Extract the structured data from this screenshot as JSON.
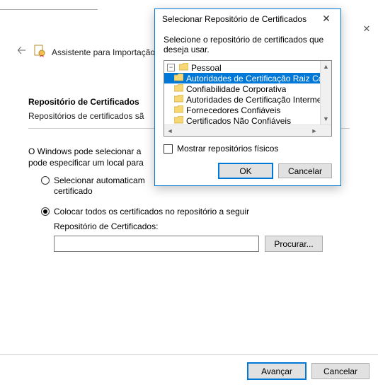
{
  "wizard": {
    "title": "Assistente para Importação de",
    "section_heading": "Repositório de Certificados",
    "section_sub": "Repositórios de certificados sã",
    "paragraph": "O Windows pode selecionar a\npode especificar um local para",
    "radio_auto": "Selecionar automaticam\ncertificado",
    "radio_place": "Colocar todos os certificados no repositório a seguir",
    "store_label": "Repositório de Certificados:",
    "store_value": "",
    "browse_label": "Procurar...",
    "next_label": "Avançar",
    "cancel_label": "Cancelar"
  },
  "dialog": {
    "title": "Selecionar Repositório de Certificados",
    "message": "Selecione o repositório de certificados que deseja usar.",
    "tree": [
      {
        "label": "Pessoal",
        "selected": false
      },
      {
        "label": "Autoridades de Certificação Raiz Confiáveis",
        "selected": true
      },
      {
        "label": "Confiabilidade Corporativa",
        "selected": false
      },
      {
        "label": "Autoridades de Certificação Intermediárias",
        "selected": false
      },
      {
        "label": "Fornecedores Confiáveis",
        "selected": false
      },
      {
        "label": "Certificados Não Confiáveis",
        "selected": false
      }
    ],
    "show_physical": "Mostrar repositórios físicos",
    "ok_label": "OK",
    "cancel_label": "Cancelar"
  }
}
